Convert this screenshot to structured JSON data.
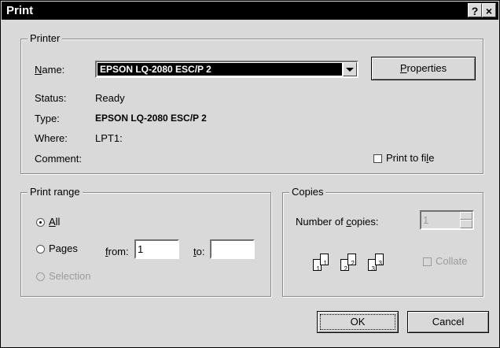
{
  "window": {
    "title": "Print",
    "help_icon": "?",
    "close_icon": "×"
  },
  "printer": {
    "legend": "Printer",
    "name_label": "Name:",
    "name_value": "EPSON LQ-2080 ESC/P 2",
    "properties_label": "Properties",
    "status_label": "Status:",
    "status_value": "Ready",
    "type_label": "Type:",
    "type_value": "EPSON LQ-2080 ESC/P 2",
    "where_label": "Where:",
    "where_value": "LPT1:",
    "comment_label": "Comment:",
    "print_to_file_label": "Print to file"
  },
  "print_range": {
    "legend": "Print range",
    "all_label": "All",
    "pages_label": "Pages",
    "from_label": "from:",
    "from_value": "1",
    "to_label": "to:",
    "to_value": "",
    "selection_label": "Selection"
  },
  "copies": {
    "legend": "Copies",
    "number_label": "Number of copies:",
    "number_value": "1",
    "collate_label": "Collate",
    "pages": [
      "1",
      "1",
      "2",
      "2",
      "3",
      "3"
    ]
  },
  "buttons": {
    "ok": "OK",
    "cancel": "Cancel"
  }
}
